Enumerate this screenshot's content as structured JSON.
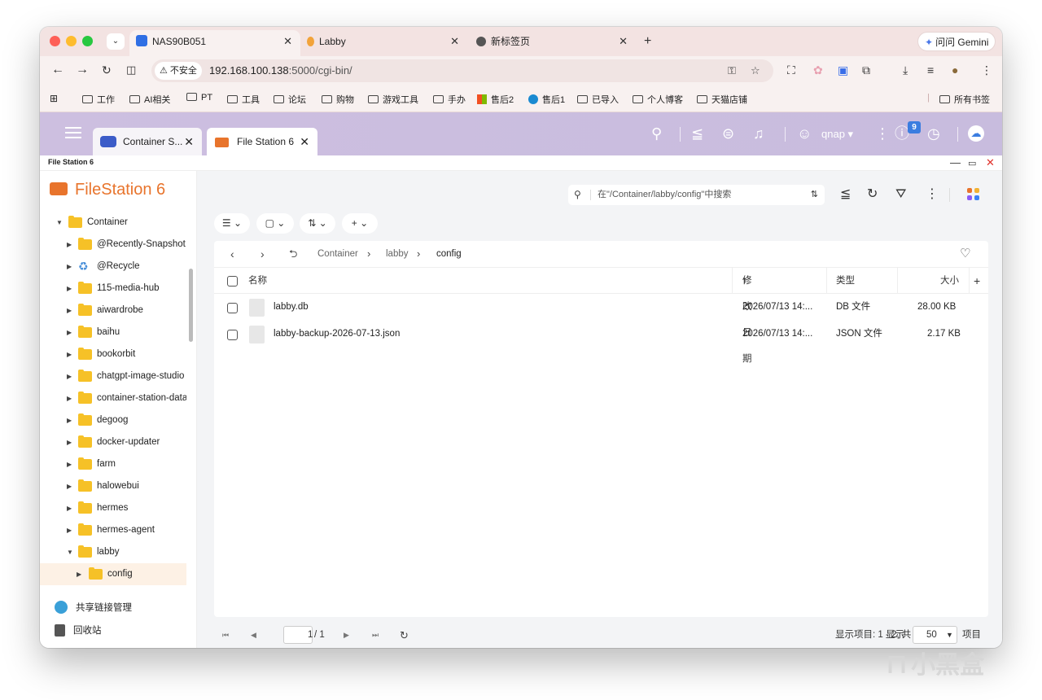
{
  "browser": {
    "tabs": [
      {
        "title": "NAS90B051",
        "icon": "qnap-tab-icon",
        "active": true
      },
      {
        "title": "Labby",
        "icon": "labby-tab-icon",
        "active": false
      },
      {
        "title": "新标签页",
        "icon": "chrome-tab-icon",
        "active": false
      }
    ],
    "gemini_label": "问问 Gemini",
    "insecure_label": "不安全",
    "url_host": "192.168.100.138",
    "url_rest": ":5000/cgi-bin/",
    "bookmarks": [
      "工作",
      "AI相关",
      "PT",
      "工具",
      "论坛",
      "购物",
      "游戏工具",
      "手办",
      "售后2",
      "售后1",
      "已导入",
      "个人博客",
      "天猫店铺"
    ],
    "all_bookmarks": "所有书签"
  },
  "qnap": {
    "tabs": [
      {
        "title": "Container S..."
      },
      {
        "title": "File Station 6"
      }
    ],
    "user": "qnap",
    "notification_count": "9"
  },
  "app": {
    "window_title": "File Station 6",
    "brand": "FileStation 6",
    "tree": [
      {
        "label": "Container",
        "depth": 0,
        "expanded": true,
        "type": "folder"
      },
      {
        "label": "@Recently-Snapshot",
        "depth": 1,
        "type": "folder"
      },
      {
        "label": "@Recycle",
        "depth": 1,
        "type": "recycle"
      },
      {
        "label": "115-media-hub",
        "depth": 1,
        "type": "folder"
      },
      {
        "label": "aiwardrobe",
        "depth": 1,
        "type": "folder"
      },
      {
        "label": "baihu",
        "depth": 1,
        "type": "folder"
      },
      {
        "label": "bookorbit",
        "depth": 1,
        "type": "folder"
      },
      {
        "label": "chatgpt-image-studio",
        "depth": 1,
        "type": "folder"
      },
      {
        "label": "container-station-data",
        "depth": 1,
        "type": "folder"
      },
      {
        "label": "degoog",
        "depth": 1,
        "type": "folder"
      },
      {
        "label": "docker-updater",
        "depth": 1,
        "type": "folder"
      },
      {
        "label": "farm",
        "depth": 1,
        "type": "folder"
      },
      {
        "label": "halowebui",
        "depth": 1,
        "type": "folder"
      },
      {
        "label": "hermes",
        "depth": 1,
        "type": "folder"
      },
      {
        "label": "hermes-agent",
        "depth": 1,
        "type": "folder"
      },
      {
        "label": "labby",
        "depth": 1,
        "expanded": true,
        "type": "folder"
      },
      {
        "label": "config",
        "depth": 2,
        "selected": true,
        "type": "folder"
      }
    ],
    "share_links": "共享链接管理",
    "recycle_bin": "回收站",
    "search_placeholder": "在\"/Container/labby/config\"中搜索",
    "breadcrumb": [
      "Container",
      "labby",
      "config"
    ],
    "columns": {
      "name": "名称",
      "modified": "修改日期",
      "type": "类型",
      "size": "大小"
    },
    "files": [
      {
        "name": "labby.db",
        "modified": "2026/07/13 14:...",
        "type": "DB 文件",
        "size": "28.00 KB"
      },
      {
        "name": "labby-backup-2026-07-13.json",
        "modified": "2026/07/13 14:...",
        "type": "JSON 文件",
        "size": "2.17 KB"
      }
    ],
    "pager": {
      "page": "1",
      "total_pages": "/ 1",
      "summary": "显示项目: 1 - 2, 共 2",
      "show_label": "显示",
      "page_size": "50",
      "items_label": "项目"
    }
  },
  "watermark": "小黑盒",
  "colors": {
    "accent": "#e8742c",
    "qnap_bar": "#cdbfe0",
    "chrome": "#f3e3e2",
    "folder": "#f6c127"
  }
}
